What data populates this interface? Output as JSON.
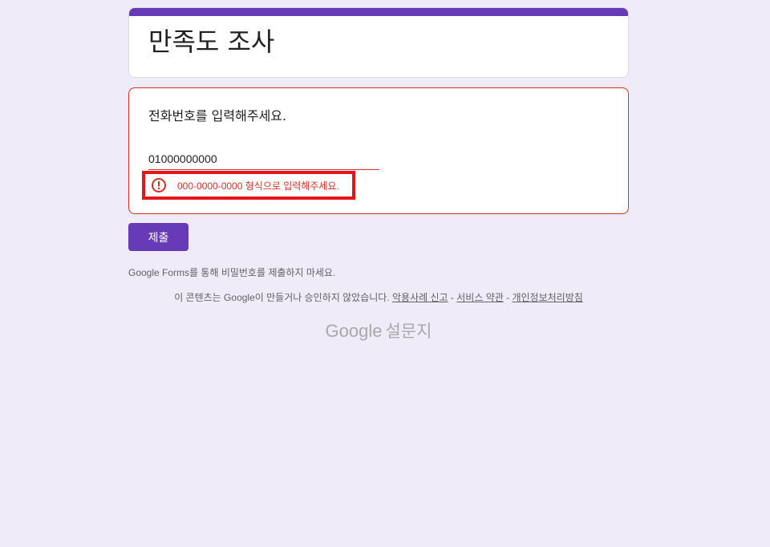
{
  "form": {
    "title": "만족도 조사",
    "accent_color": "#673ab7"
  },
  "question": {
    "label": "전화번호를 입력해주세요.",
    "answer_value": "01000000000",
    "error_message": "000-0000-0000 형식으로 입력해주세요.",
    "error_icon": "error-circle-icon",
    "error_color": "#d93025"
  },
  "actions": {
    "submit_label": "제출"
  },
  "footer": {
    "password_warning": "Google Forms를 통해 비밀번호를 제출하지 마세요.",
    "disclaimer_text": "이 콘텐츠는 Google이 만들거나 승인하지 않았습니다.",
    "report_abuse": "악용사례 신고",
    "terms": "서비스 약관",
    "privacy": "개인정보처리방침",
    "separator": " - ",
    "brand_google": "Google",
    "brand_product": "설문지"
  }
}
